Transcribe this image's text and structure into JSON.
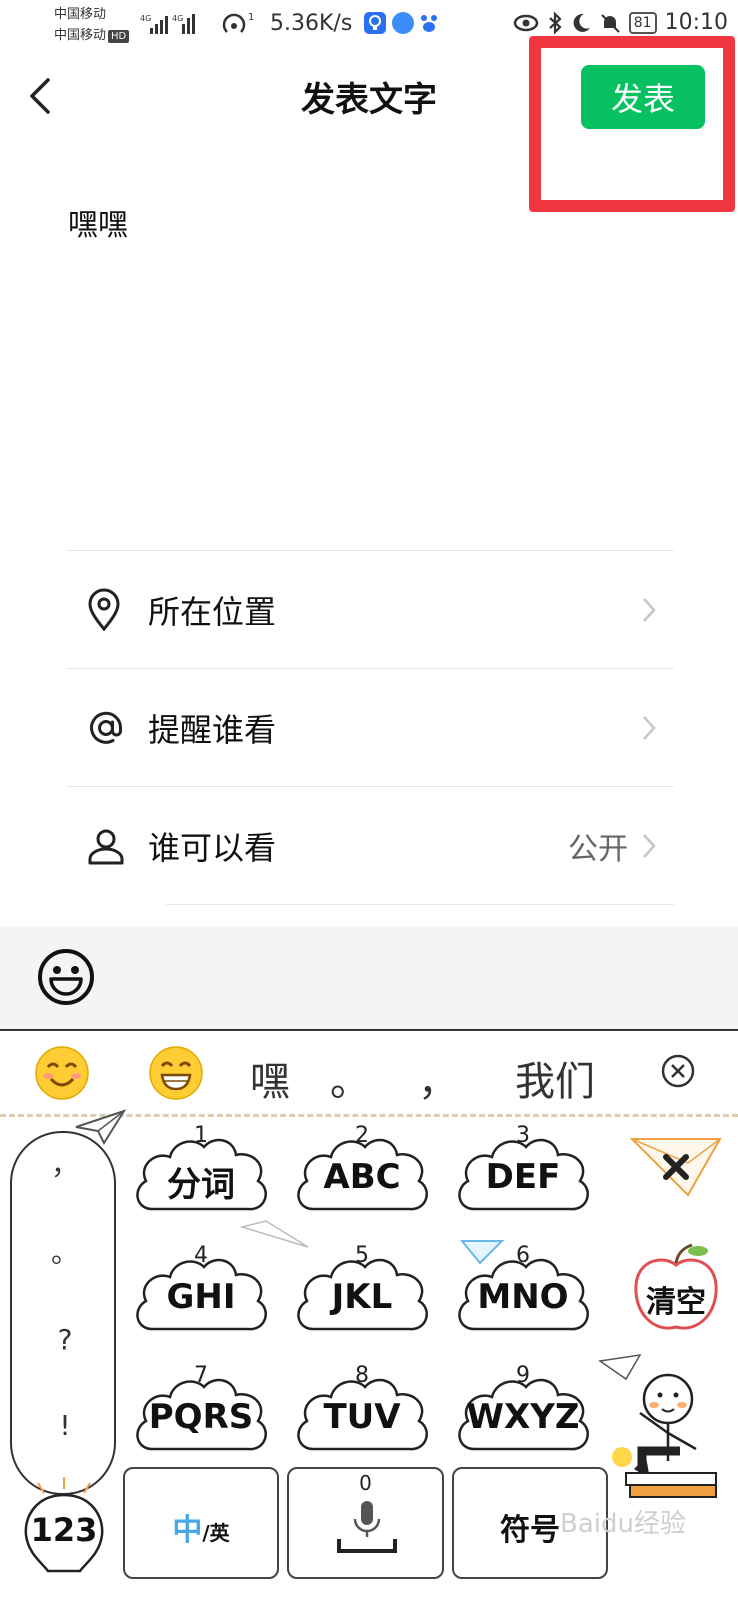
{
  "status_bar": {
    "carrier_1": "中国移动",
    "carrier_2": "中国移动",
    "carrier_hd": "HD",
    "net_speed": "5.36K/s",
    "battery": "81",
    "time": "10:10",
    "sig_label": "4G"
  },
  "header": {
    "title": "发表文字",
    "publish_label": "发表"
  },
  "post": {
    "text": "嘿嘿"
  },
  "options": [
    {
      "label": "所在位置",
      "value": "",
      "icon": "location-pin-icon"
    },
    {
      "label": "提醒谁看",
      "value": "",
      "icon": "at-icon"
    },
    {
      "label": "谁可以看",
      "value": "公开",
      "icon": "person-icon"
    }
  ],
  "keyboard": {
    "candidates": [
      "嘿",
      "。",
      "，",
      "我们"
    ],
    "punctuation": [
      "，",
      "。",
      "?",
      "!"
    ],
    "keys": [
      {
        "num": "1",
        "label": "分词"
      },
      {
        "num": "2",
        "label": "ABC"
      },
      {
        "num": "3",
        "label": "DEF"
      },
      {
        "num": "4",
        "label": "GHI"
      },
      {
        "num": "5",
        "label": "JKL"
      },
      {
        "num": "6",
        "label": "MNO"
      },
      {
        "num": "7",
        "label": "PQRS"
      },
      {
        "num": "8",
        "label": "TUV"
      },
      {
        "num": "9",
        "label": "WXYZ"
      }
    ],
    "clear_label": "清空",
    "numbers_label": "123",
    "lang_zh": "中",
    "lang_en": "/英",
    "space_num": "0",
    "symbols_label": "符号"
  },
  "watermark": "Baidu经验",
  "colors": {
    "publish_green": "#07c160",
    "highlight_red": "#f0373f"
  }
}
